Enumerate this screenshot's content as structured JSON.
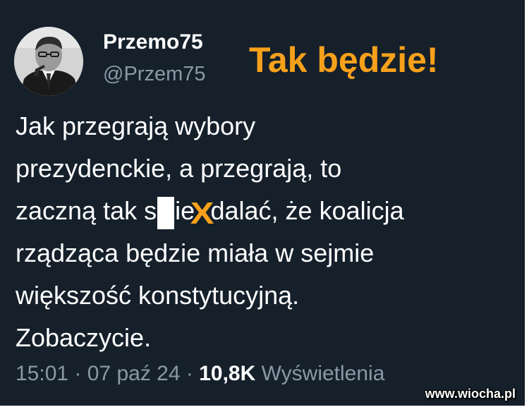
{
  "author": {
    "display_name": "Przemo75",
    "handle": "@Przem75",
    "avatar_icon": "profile-photo-icon"
  },
  "overlay": {
    "headline": "Tak będzie!",
    "censor_mark": "X",
    "headline_color": "#f7a11b"
  },
  "tweet": {
    "lines": [
      {
        "text": "Jak przegrają wybory"
      },
      {
        "text": "prezydenckie, a przegrają, to"
      },
      {
        "before": "zaczną tak s",
        "middle": "ie",
        "after": "dalać, że koalicja"
      },
      {
        "text": "rządząca będzie miała w sejmie"
      },
      {
        "text": "większość konstytucyjną."
      },
      {
        "text": "Zobaczycie."
      }
    ]
  },
  "meta": {
    "time": "15:01",
    "separator": " · ",
    "date": "07 paź 24",
    "views_count": "10,8K",
    "views_label": "Wyświetlenia"
  },
  "watermark": "www.wiocha.pl",
  "colors": {
    "background": "#15202b",
    "text_primary": "#ffffff",
    "text_secondary": "#8b98a5"
  }
}
